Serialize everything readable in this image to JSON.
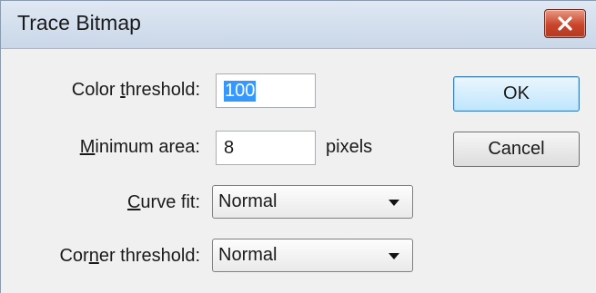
{
  "window": {
    "title": "Trace Bitmap"
  },
  "fields": {
    "color_threshold": {
      "label_pre": "Color ",
      "label_mn": "t",
      "label_post": "hreshold:",
      "value": "100"
    },
    "minimum_area": {
      "label_pre": "",
      "label_mn": "M",
      "label_post": "inimum area:",
      "value": "8",
      "unit": "pixels"
    },
    "curve_fit": {
      "label_pre": "",
      "label_mn": "C",
      "label_post": "urve fit:",
      "value": "Normal"
    },
    "corner_threshold": {
      "label_pre": "Cor",
      "label_mn": "n",
      "label_post": "er threshold:",
      "value": "Normal"
    }
  },
  "buttons": {
    "ok": "OK",
    "cancel": "Cancel"
  },
  "icons": {
    "close": "close-icon",
    "dropdown": "chevron-down-icon"
  },
  "colors": {
    "selection": "#3399ff",
    "close_button": "#c9452b",
    "default_button": "#bee6fd"
  }
}
